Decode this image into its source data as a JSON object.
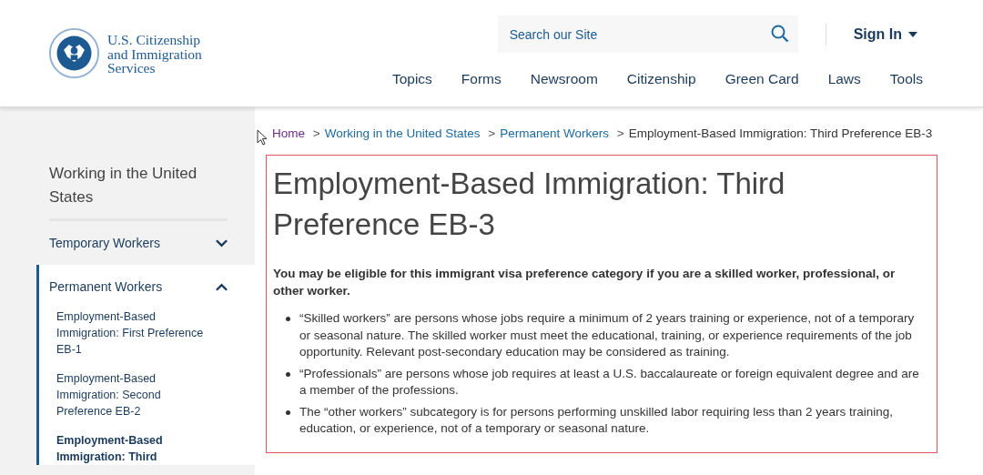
{
  "header": {
    "logo_lines": [
      "U.S. Citizenship",
      "and Immigration",
      "Services"
    ],
    "search": {
      "placeholder": "Search our Site"
    },
    "sign_in": {
      "label": "Sign In"
    },
    "nav": [
      {
        "label": "Topics"
      },
      {
        "label": "Forms"
      },
      {
        "label": "Newsroom"
      },
      {
        "label": "Citizenship"
      },
      {
        "label": "Green Card"
      },
      {
        "label": "Laws"
      },
      {
        "label": "Tools"
      }
    ]
  },
  "sidebar": {
    "title": "Working in the United States",
    "sections": [
      {
        "label": "Temporary Workers",
        "expanded": false
      },
      {
        "label": "Permanent Workers",
        "expanded": true,
        "children": [
          {
            "label": "Employment-Based Immigration: First Preference EB-1",
            "selected": false
          },
          {
            "label": "Employment-Based Immigration: Second Preference EB-2",
            "selected": false
          },
          {
            "label": "Employment-Based Immigration: Third",
            "selected": true
          }
        ]
      }
    ]
  },
  "breadcrumb": [
    {
      "label": "Home",
      "kind": "visited"
    },
    {
      "label": "Working in the United States",
      "kind": "link"
    },
    {
      "label": "Permanent Workers",
      "kind": "link"
    },
    {
      "label": "Employment-Based Immigration: Third Preference EB-3",
      "kind": "current"
    }
  ],
  "breadcrumb_separator": ">",
  "content": {
    "title": "Employment-Based Immigration: Third Preference EB-3",
    "intro": "You may be eligible for this immigrant visa preference category if you are a skilled worker, professional, or other worker.",
    "bullets": [
      "“Skilled workers” are persons whose jobs require a minimum of 2 years training or experience, not of a temporary or seasonal nature. The skilled worker must meet the educational, training, or experience requirements of the job opportunity. Relevant post-secondary education may be considered as training.",
      "“Professionals” are persons whose job requires at least a U.S. baccalaureate or foreign equivalent degree and are a member of the professions.",
      "The “other workers” subcategory is for persons performing unskilled labor requiring less than 2 years training, education, or experience, not of a temporary or seasonal nature."
    ]
  }
}
